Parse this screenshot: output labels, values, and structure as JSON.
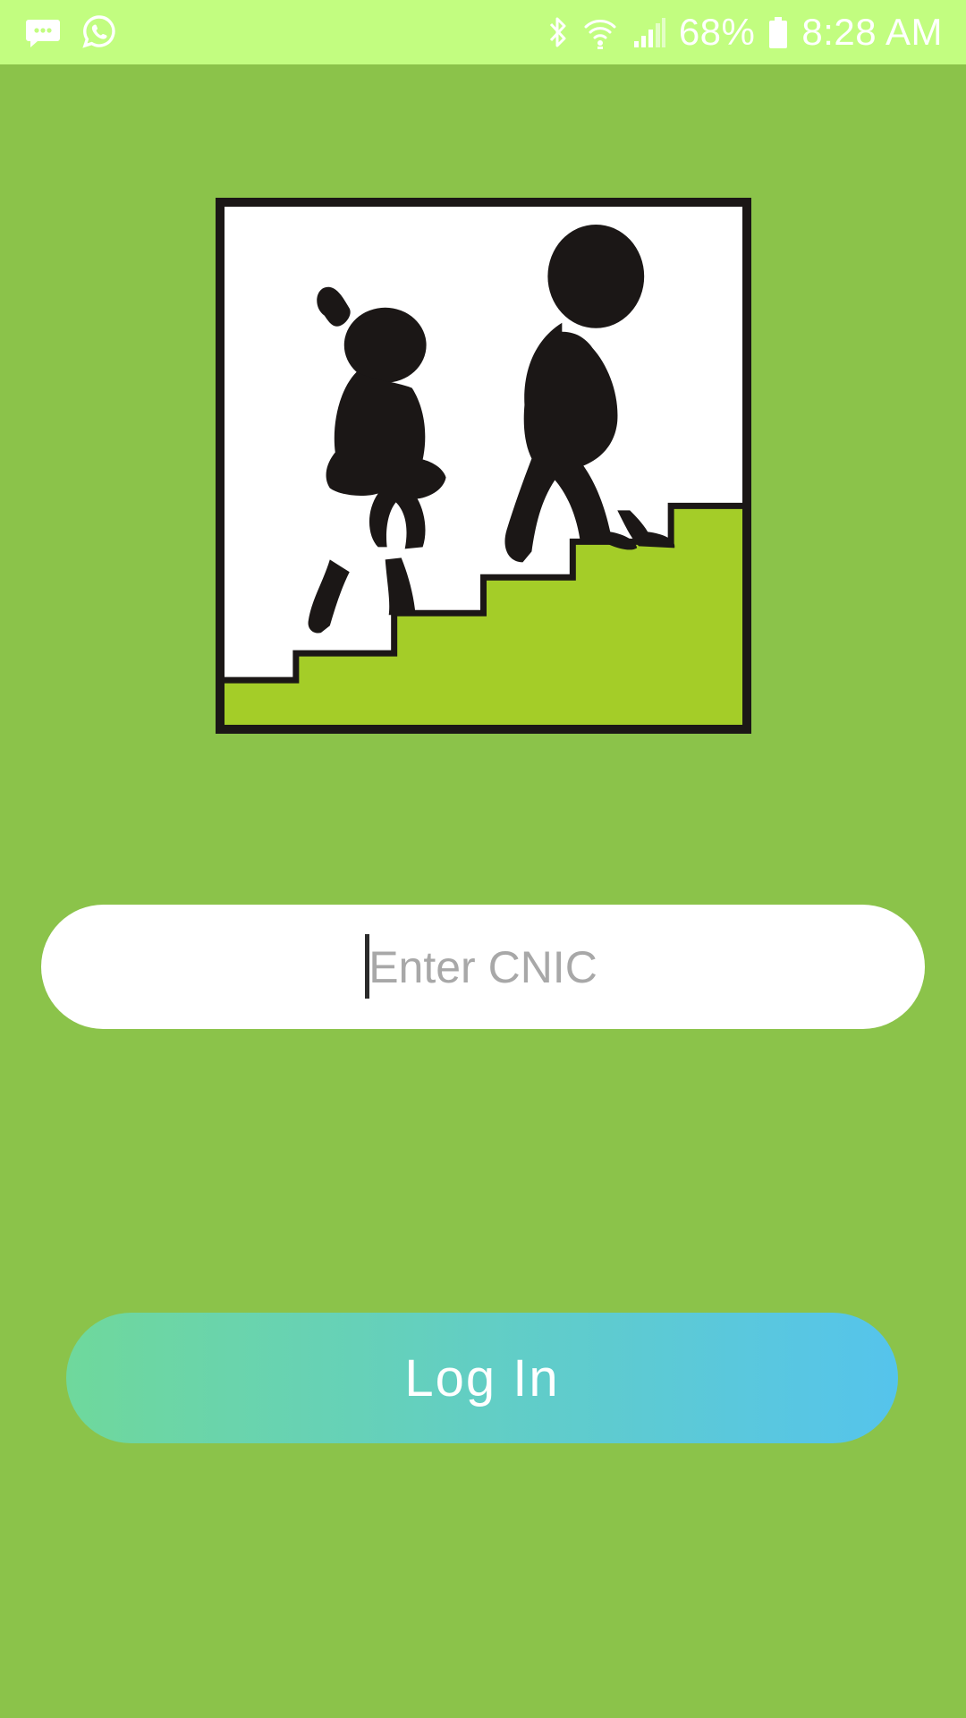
{
  "status_bar": {
    "battery_percent": "68%",
    "time": "8:28 AM",
    "icons": [
      "message-icon",
      "whatsapp-icon",
      "bluetooth-icon",
      "wifi-icon",
      "signal-icon",
      "battery-icon"
    ]
  },
  "logo": {
    "description_icon": "children-climbing-stairs-logo"
  },
  "login_form": {
    "cnic_placeholder": "Enter CNIC",
    "cnic_value": "",
    "login_label": "Log In"
  },
  "colors": {
    "background": "#8bc34a",
    "status_bar": "#c2fd80",
    "button_gradient_start": "#6fd89c",
    "button_gradient_end": "#55c4ec",
    "stairs": "#a4cd28"
  }
}
